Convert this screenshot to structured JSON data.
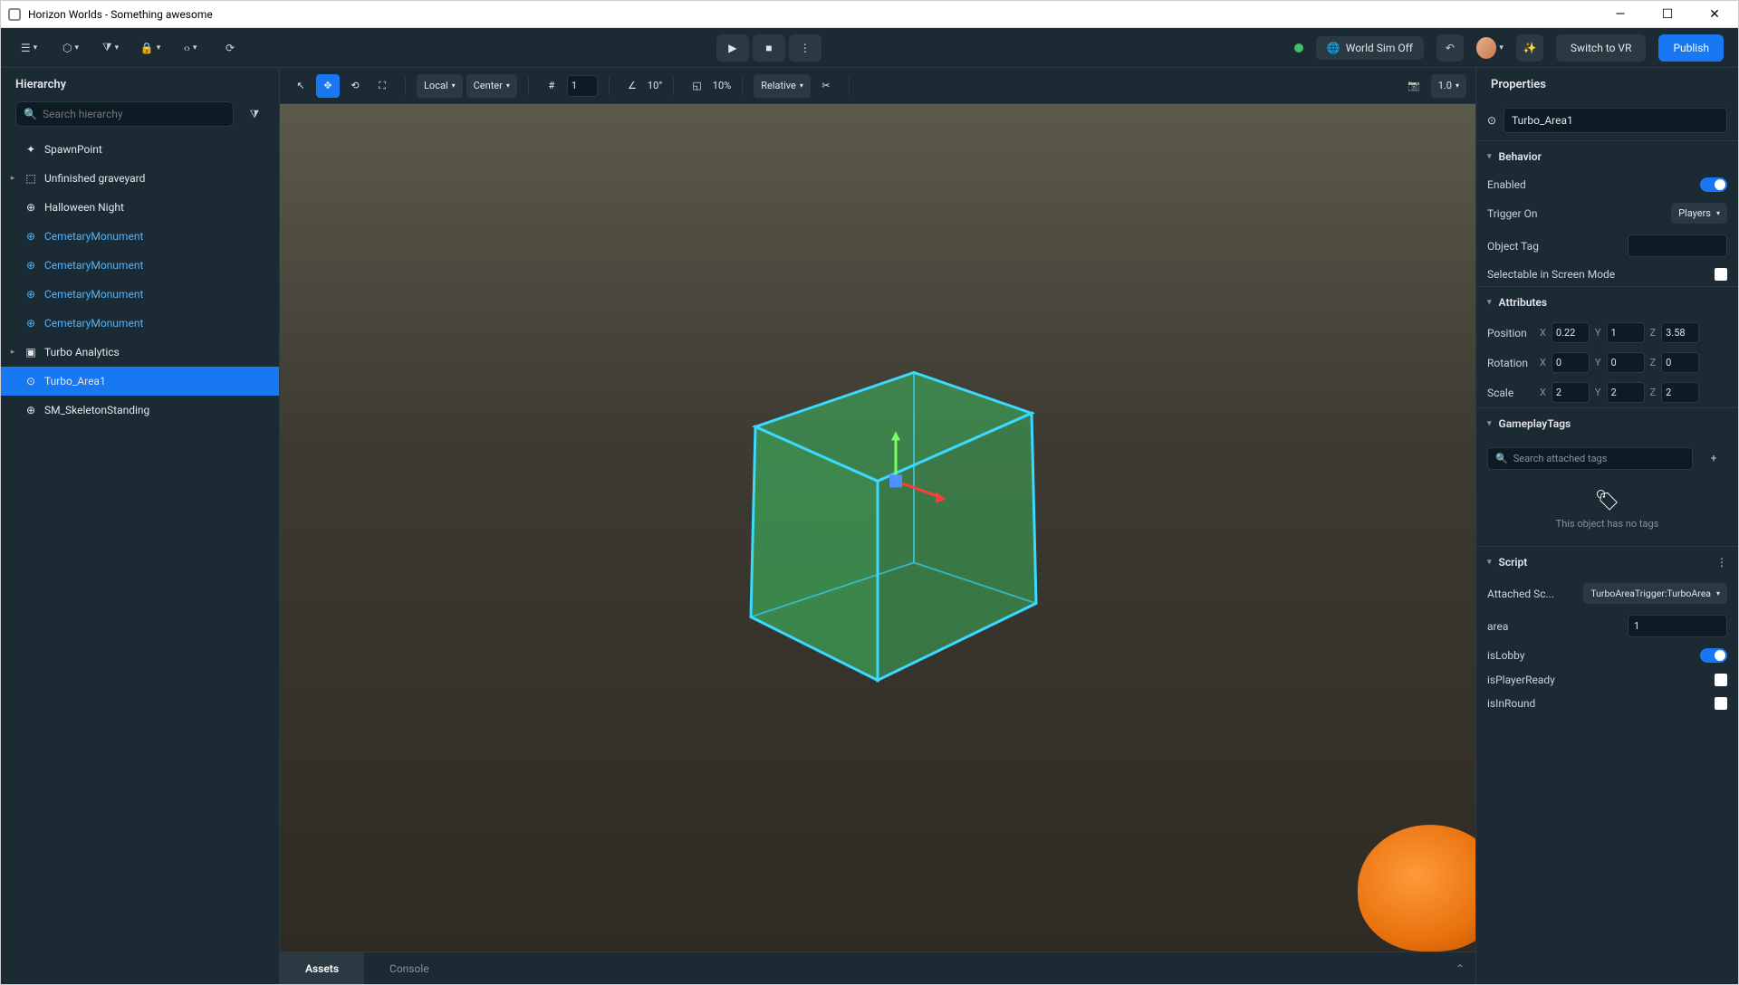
{
  "titlebar": {
    "title": "Horizon Worlds - Something awesome"
  },
  "topbar": {
    "world_sim_label": "World Sim Off",
    "switch_vr_label": "Switch to VR",
    "publish_label": "Publish"
  },
  "hierarchy": {
    "title": "Hierarchy",
    "search_placeholder": "Search hierarchy",
    "items": [
      {
        "label": "SpawnPoint",
        "icon": "✦",
        "expandable": false,
        "linked": false
      },
      {
        "label": "Unfinished graveyard",
        "icon": "⬚",
        "expandable": true,
        "linked": false
      },
      {
        "label": "Halloween Night",
        "icon": "⊕",
        "expandable": false,
        "linked": false
      },
      {
        "label": "CemetaryMonument",
        "icon": "⊕",
        "expandable": false,
        "linked": true
      },
      {
        "label": "CemetaryMonument",
        "icon": "⊕",
        "expandable": false,
        "linked": true
      },
      {
        "label": "CemetaryMonument",
        "icon": "⊕",
        "expandable": false,
        "linked": true
      },
      {
        "label": "CemetaryMonument",
        "icon": "⊕",
        "expandable": false,
        "linked": true
      },
      {
        "label": "Turbo Analytics",
        "icon": "▣",
        "expandable": true,
        "linked": false
      },
      {
        "label": "Turbo_Area1",
        "icon": "⊙",
        "expandable": false,
        "linked": false,
        "selected": true
      },
      {
        "label": "SM_SkeletonStanding",
        "icon": "⊕",
        "expandable": false,
        "linked": false
      }
    ]
  },
  "vp_toolbar": {
    "space_label": "Local",
    "pivot_label": "Center",
    "grid_value": "1",
    "angle_value": "10°",
    "scale_value": "10%",
    "relative_label": "Relative",
    "zoom_value": "1.0"
  },
  "bottom_tabs": {
    "tab1": "Assets",
    "tab2": "Console"
  },
  "properties": {
    "title": "Properties",
    "name": "Turbo_Area1",
    "sections": {
      "behavior": {
        "title": "Behavior",
        "enabled_label": "Enabled",
        "trigger_on_label": "Trigger On",
        "trigger_on_value": "Players",
        "object_tag_label": "Object Tag",
        "object_tag_value": "",
        "selectable_label": "Selectable in Screen Mode"
      },
      "attributes": {
        "title": "Attributes",
        "position_label": "Position",
        "position": {
          "x": "0.22",
          "y": "1",
          "z": "3.58"
        },
        "rotation_label": "Rotation",
        "rotation": {
          "x": "0",
          "y": "0",
          "z": "0"
        },
        "scale_label": "Scale",
        "scale": {
          "x": "2",
          "y": "2",
          "z": "2"
        }
      },
      "gameplay_tags": {
        "title": "GameplayTags",
        "search_placeholder": "Search attached tags",
        "empty_text": "This object has no tags"
      },
      "script": {
        "title": "Script",
        "attached_label": "Attached Sc...",
        "attached_value": "TurboAreaTrigger:TurboArea",
        "area_label": "area",
        "area_value": "1",
        "is_lobby_label": "isLobby",
        "is_player_ready_label": "isPlayerReady",
        "is_in_round_label": "isInRound"
      }
    }
  }
}
